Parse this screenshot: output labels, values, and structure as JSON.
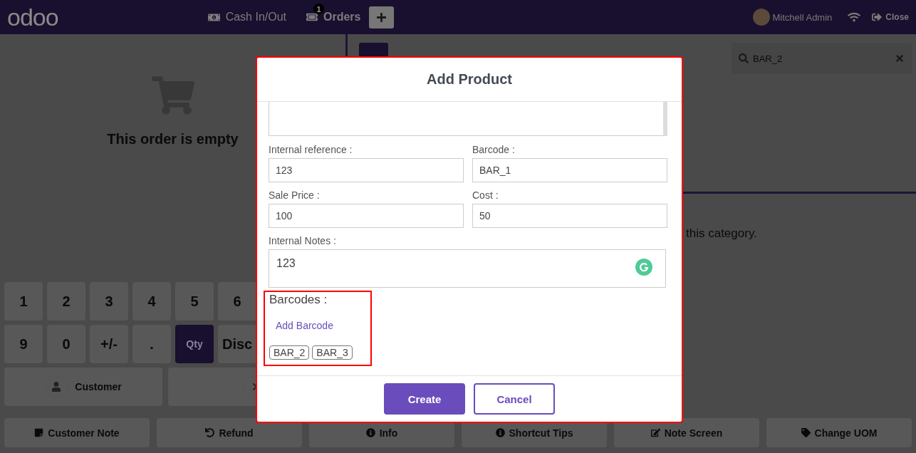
{
  "header": {
    "logo": "odoo",
    "cash_button": "Cash In/Out",
    "orders": {
      "label": "Orders",
      "badge": "1"
    },
    "user": "Mitchell Admin",
    "close_label": "Close"
  },
  "order": {
    "empty_text": "This order is empty"
  },
  "numpad": [
    {
      "label": "1",
      "selected": false
    },
    {
      "label": "2",
      "selected": false
    },
    {
      "label": "3",
      "selected": false
    },
    {
      "label": "4",
      "selected": false
    },
    {
      "label": "5",
      "selected": false
    },
    {
      "label": "6",
      "selected": false
    },
    {
      "label": "9",
      "selected": false
    },
    {
      "label": "0",
      "selected": false
    },
    {
      "label": "+/-",
      "selected": false
    },
    {
      "label": ".",
      "selected": false
    },
    {
      "label": "Qty",
      "selected": true
    },
    {
      "label": "Disc",
      "selected": false
    }
  ],
  "customer_button": "Customer",
  "products": {
    "search": {
      "value": "BAR_2"
    },
    "category_message": "this category."
  },
  "action_buttons": [
    {
      "label": "Customer Note"
    },
    {
      "label": "Refund"
    },
    {
      "label": "Info"
    },
    {
      "label": "Shortcut Tips"
    },
    {
      "label": "Note Screen"
    },
    {
      "label": "Change UOM"
    }
  ],
  "modal": {
    "title": "Add Product",
    "fields": [
      {
        "label": "Internal reference :",
        "value": "123"
      },
      {
        "label": "Barcode :",
        "value": "BAR_1"
      },
      {
        "label": "Sale Price :",
        "value": "100"
      },
      {
        "label": "Cost :",
        "value": "50"
      }
    ],
    "notes": {
      "label": "Internal Notes :",
      "value": "123"
    },
    "barcodes": {
      "label": "Barcodes :",
      "add_label": "Add Barcode",
      "tags": [
        "BAR_2",
        "BAR_3"
      ]
    },
    "buttons": {
      "create": "Create",
      "cancel": "Cancel"
    }
  }
}
